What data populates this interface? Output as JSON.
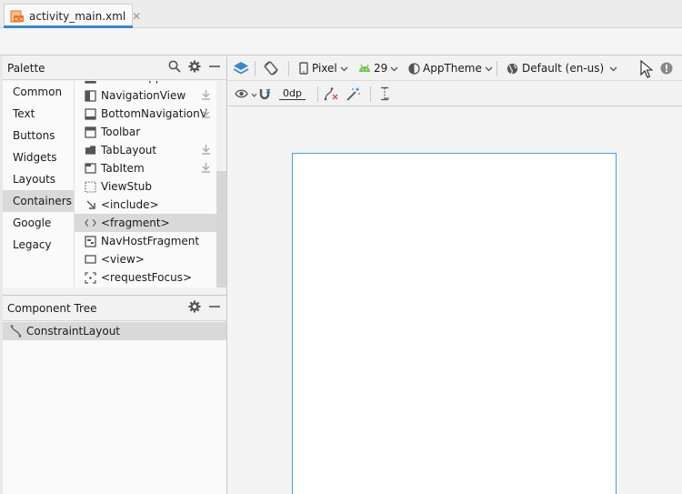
{
  "tab": {
    "filename": "activity_main.xml",
    "close": "✕"
  },
  "palette": {
    "title": "Palette",
    "categories": [
      "Common",
      "Text",
      "Buttons",
      "Widgets",
      "Layouts",
      "Containers",
      "Google",
      "Legacy"
    ],
    "selected_category": "Containers",
    "items": [
      {
        "label": "BottomAppBar",
        "icon": "bottom-app-bar-icon",
        "download": false
      },
      {
        "label": "NavigationView",
        "icon": "navigation-view-icon",
        "download": true
      },
      {
        "label": "BottomNavigationV",
        "icon": "bottom-navigation-icon",
        "download": true
      },
      {
        "label": "Toolbar",
        "icon": "toolbar-icon",
        "download": false
      },
      {
        "label": "TabLayout",
        "icon": "tab-layout-icon",
        "download": true
      },
      {
        "label": "TabItem",
        "icon": "tab-item-icon",
        "download": true
      },
      {
        "label": "ViewStub",
        "icon": "view-stub-icon",
        "download": false
      },
      {
        "label": "<include>",
        "icon": "include-icon",
        "download": false
      },
      {
        "label": "<fragment>",
        "icon": "fragment-icon",
        "download": false
      },
      {
        "label": "NavHostFragment",
        "icon": "nav-host-fragment-icon",
        "download": false
      },
      {
        "label": "<view>",
        "icon": "view-icon",
        "download": false
      },
      {
        "label": "<requestFocus>",
        "icon": "request-focus-icon",
        "download": false
      }
    ],
    "selected_item": "<fragment>"
  },
  "component_tree": {
    "title": "Component Tree",
    "root": "ConstraintLayout"
  },
  "toolbar": {
    "device": "Pixel",
    "api_level": "29",
    "theme": "AppTheme",
    "locale": "Default (en-us)",
    "margin": "0dp"
  },
  "colors": {
    "accent": "#3c87c8",
    "android_green": "#78c257",
    "blueprint": "#4d9dd4"
  }
}
